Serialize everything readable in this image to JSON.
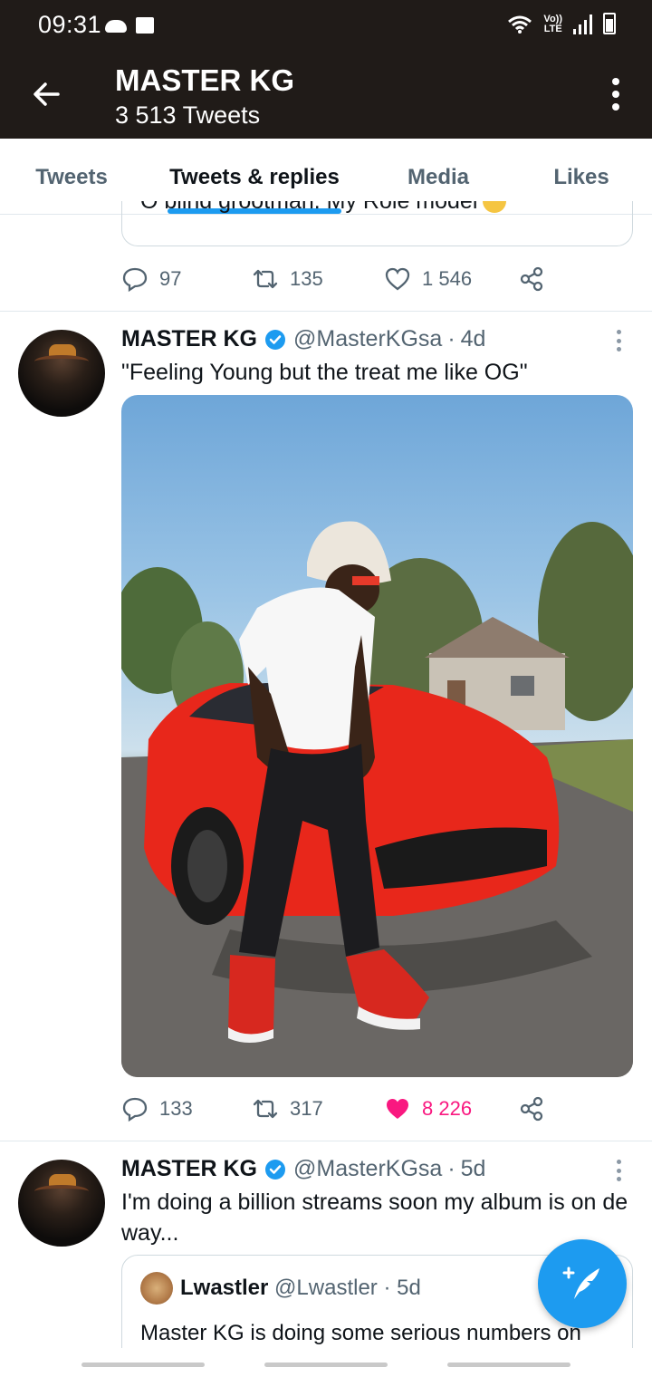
{
  "status_bar": {
    "time": "09:31",
    "network_line1": "Vo))",
    "network_line2": "LTE",
    "icons": [
      "cloud-icon",
      "folder-icon",
      "wifi-icon",
      "signal-icon",
      "battery-icon"
    ]
  },
  "header": {
    "title": "MASTER KG",
    "subtitle": "3 513 Tweets"
  },
  "tabs": [
    {
      "label": "Tweets",
      "active": false
    },
    {
      "label": "Tweets & replies",
      "active": true
    },
    {
      "label": "Media",
      "active": false
    },
    {
      "label": "Likes",
      "active": false
    }
  ],
  "tweet0": {
    "quote_remnant": "O blind grootman. My Role model",
    "replies": "97",
    "retweets": "135",
    "likes": "1 546"
  },
  "tweet1": {
    "name": "MASTER KG",
    "handle": "@MasterKGsa",
    "separator": "·",
    "time": "4d",
    "text": "\"Feeling Young but the treat me like OG\"",
    "replies": "133",
    "retweets": "317",
    "likes": "8 226",
    "liked": true
  },
  "tweet2": {
    "name": "MASTER KG",
    "handle": "@MasterKGsa",
    "separator": "·",
    "time": "5d",
    "text": "I'm doing a billion streams soon my album is on de way...",
    "quote": {
      "name": "Lwastler",
      "handle": "@Lwastler",
      "separator": "·",
      "time": "5d",
      "text": "Master KG is doing some serious numbers on"
    }
  },
  "colors": {
    "header_bg": "#201b18",
    "accent_blue": "#1d9bf0",
    "like_pink": "#f91880",
    "secondary_text": "#536471"
  }
}
